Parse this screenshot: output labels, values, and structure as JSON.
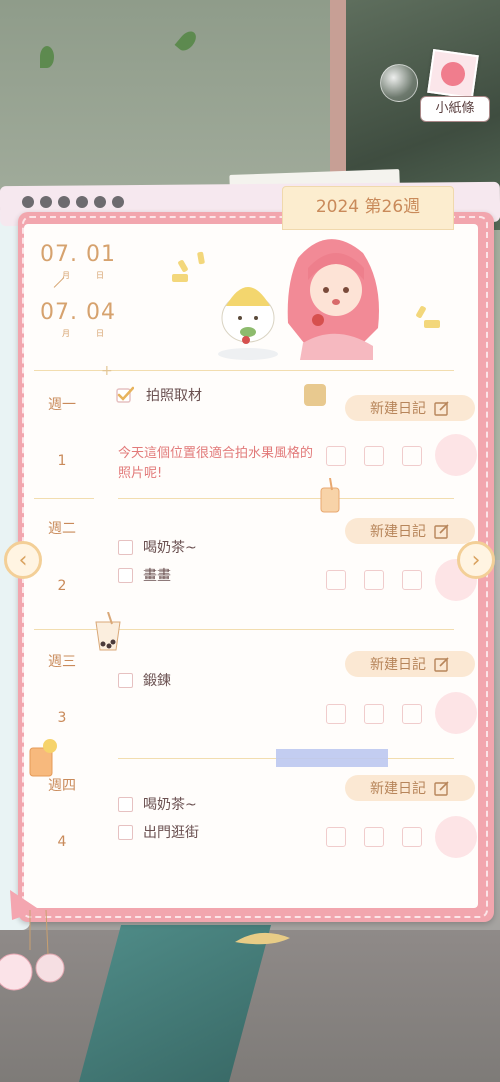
{
  "header": {
    "week_title": "2024 第26週",
    "note_widget_label": "小紙條"
  },
  "date_range": {
    "start_month": "07.",
    "start_day": "01",
    "end_month": "07.",
    "end_day": "04",
    "month_unit": "月",
    "day_unit": "日"
  },
  "new_entry_label": "新建日記",
  "days": [
    {
      "weekday": "週一",
      "number": "1",
      "tasks": [
        {
          "text": "拍照取材",
          "checked": true
        }
      ],
      "memo": "今天這個位置很適合拍水果風格的照片呢!"
    },
    {
      "weekday": "週二",
      "number": "2",
      "tasks": [
        {
          "text": "喝奶茶~",
          "checked": false
        },
        {
          "text": "畫畫",
          "checked": false
        }
      ]
    },
    {
      "weekday": "週三",
      "number": "3",
      "tasks": [
        {
          "text": "鍛鍊",
          "checked": false
        }
      ]
    },
    {
      "weekday": "週四",
      "number": "4",
      "tasks": [
        {
          "text": "喝奶茶~",
          "checked": false
        },
        {
          "text": "出門逛街",
          "checked": false
        }
      ]
    }
  ],
  "icons": {
    "prev": "chevron-left-icon",
    "next": "chevron-right-icon",
    "edit": "pencil-icon",
    "gift": "gift-icon"
  },
  "colors": {
    "accent": "#c98a5a",
    "frame_pink": "#f2a6ae",
    "memo_red": "#e27a7a",
    "button_bg": "#fbe8d3"
  }
}
